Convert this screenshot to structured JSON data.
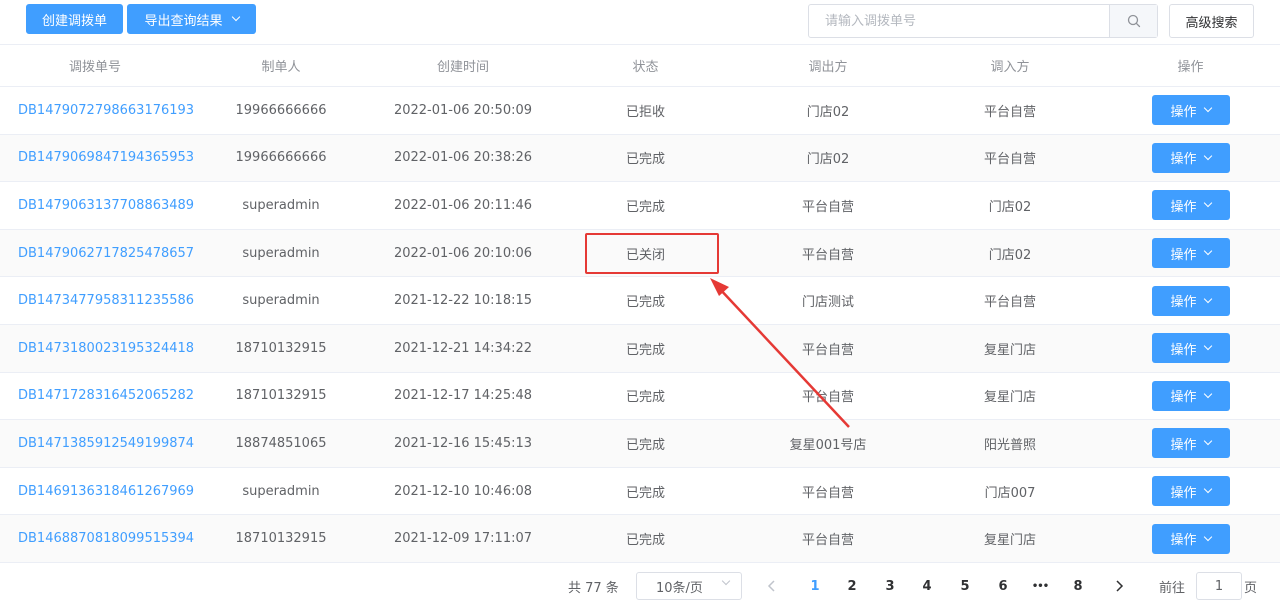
{
  "toolbar": {
    "create_label": "创建调拨单",
    "export_label": "导出查询结果",
    "search_placeholder": "请输入调拨单号",
    "advanced_label": "高级搜索"
  },
  "table": {
    "headers": [
      "调拨单号",
      "制单人",
      "创建时间",
      "状态",
      "调出方",
      "调入方",
      "操作"
    ],
    "rows": [
      {
        "id": "DB1479072798663176193",
        "creator": "19966666666",
        "time": "2022-01-06 20:50:09",
        "status": "已拒收",
        "from": "门店02",
        "to": "平台自营",
        "action": "操作"
      },
      {
        "id": "DB1479069847194365953",
        "creator": "19966666666",
        "time": "2022-01-06 20:38:26",
        "status": "已完成",
        "from": "门店02",
        "to": "平台自营",
        "action": "操作"
      },
      {
        "id": "DB1479063137708863489",
        "creator": "superadmin",
        "time": "2022-01-06 20:11:46",
        "status": "已完成",
        "from": "平台自营",
        "to": "门店02",
        "action": "操作"
      },
      {
        "id": "DB1479062717825478657",
        "creator": "superadmin",
        "time": "2022-01-06 20:10:06",
        "status": "已关闭",
        "from": "平台自营",
        "to": "门店02",
        "action": "操作"
      },
      {
        "id": "DB1473477958311235586",
        "creator": "superadmin",
        "time": "2021-12-22 10:18:15",
        "status": "已完成",
        "from": "门店测试",
        "to": "平台自营",
        "action": "操作"
      },
      {
        "id": "DB1473180023195324418",
        "creator": "18710132915",
        "time": "2021-12-21 14:34:22",
        "status": "已完成",
        "from": "平台自营",
        "to": "复星门店",
        "action": "操作"
      },
      {
        "id": "DB1471728316452065282",
        "creator": "18710132915",
        "time": "2021-12-17 14:25:48",
        "status": "已完成",
        "from": "平台自营",
        "to": "复星门店",
        "action": "操作"
      },
      {
        "id": "DB1471385912549199874",
        "creator": "18874851065",
        "time": "2021-12-16 15:45:13",
        "status": "已完成",
        "from": "复星001号店",
        "to": "阳光普照",
        "action": "操作"
      },
      {
        "id": "DB1469136318461267969",
        "creator": "superadmin",
        "time": "2021-12-10 10:46:08",
        "status": "已完成",
        "from": "平台自营",
        "to": "门店007",
        "action": "操作"
      },
      {
        "id": "DB1468870818099515394",
        "creator": "18710132915",
        "time": "2021-12-09 17:11:07",
        "status": "已完成",
        "from": "平台自营",
        "to": "复星门店",
        "action": "操作"
      }
    ]
  },
  "pagination": {
    "total": "共 77 条",
    "page_size": "10条/页",
    "pages": [
      "1",
      "2",
      "3",
      "4",
      "5",
      "6",
      "•••",
      "8"
    ],
    "current": "1",
    "jump_prefix": "前往",
    "jump_value": "1",
    "jump_suffix": "页"
  },
  "colors": {
    "primary": "#409eff",
    "annotation": "#e53935"
  }
}
